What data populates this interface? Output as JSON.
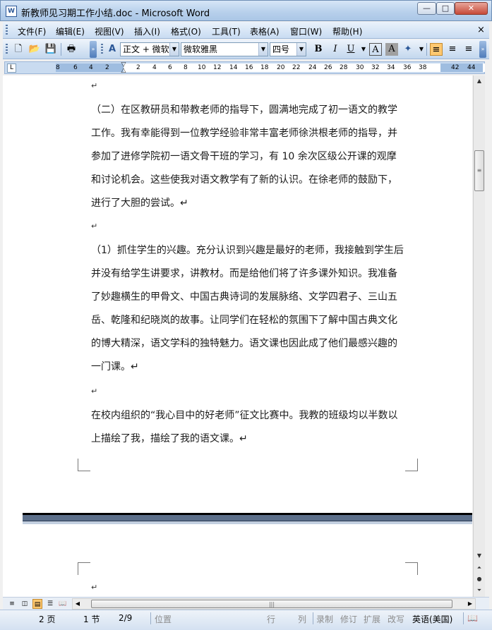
{
  "window": {
    "title": "新教师见习期工作小结.doc - Microsoft Word",
    "app_icon": "W",
    "controls": {
      "minimize": "—",
      "maximize": "□",
      "close": "✕"
    }
  },
  "menu": {
    "items": [
      "文件(F)",
      "编辑(E)",
      "视图(V)",
      "插入(I)",
      "格式(O)",
      "工具(T)",
      "表格(A)",
      "窗口(W)",
      "帮助(H)"
    ],
    "close_doc": "×"
  },
  "toolbar": {
    "style_value": "正文 + 微软",
    "font_value": "微软雅黑",
    "size_value": "四号",
    "bold": "B",
    "italic": "I",
    "underline": "U",
    "char_border": "A",
    "char_shading": "A",
    "highlight": "A",
    "align_left_active": true
  },
  "ruler": {
    "ticks": [
      "8",
      "6",
      "4",
      "2",
      "2",
      "4",
      "6",
      "8",
      "10",
      "12",
      "14",
      "16",
      "18",
      "20",
      "22",
      "24",
      "26",
      "28",
      "30",
      "32",
      "34",
      "36",
      "38",
      "42",
      "44"
    ],
    "tab_selector": "L"
  },
  "document": {
    "para_mark": "↵",
    "para1": "（二）在区教研员和带教老师的指导下，圆满地完成了初一语文的教学工作。我有幸能得到一位教学经验非常丰富老师徐洪根老师的指导，并参加了进修学院初一语文骨干班的学习，有 10 余次区级公开课的观摩和讨论机会。这些使我对语文教学有了新的认识。在徐老师的鼓励下，进行了大胆的尝试。↵",
    "para2": "（1）抓住学生的兴趣。充分认识到兴趣是最好的老师，我接触到学生后并没有给学生讲要求，讲教材。而是给他们将了许多课外知识。我准备了妙趣横生的甲骨文、中国古典诗词的发展脉络、文学四君子、三山五岳、乾隆和纪晓岚的故事。让同学们在轻松的氛围下了解中国古典文化的博大精深，语文学科的独特魅力。语文课也因此成了他们最感兴趣的一门课。↵",
    "para3": "在校内组织的“我心目中的好老师”征文比赛中。我教的班级均以半数以上描绘了我，描绘了我的语文课。↵"
  },
  "statusbar": {
    "page": "2 页",
    "section": "1 节",
    "page_of": "2/9",
    "position": "位置",
    "line": "行",
    "column": "列",
    "rec": "录制",
    "trk": "修订",
    "ext": "扩展",
    "ovr": "改写",
    "language": "英语(美国)"
  }
}
